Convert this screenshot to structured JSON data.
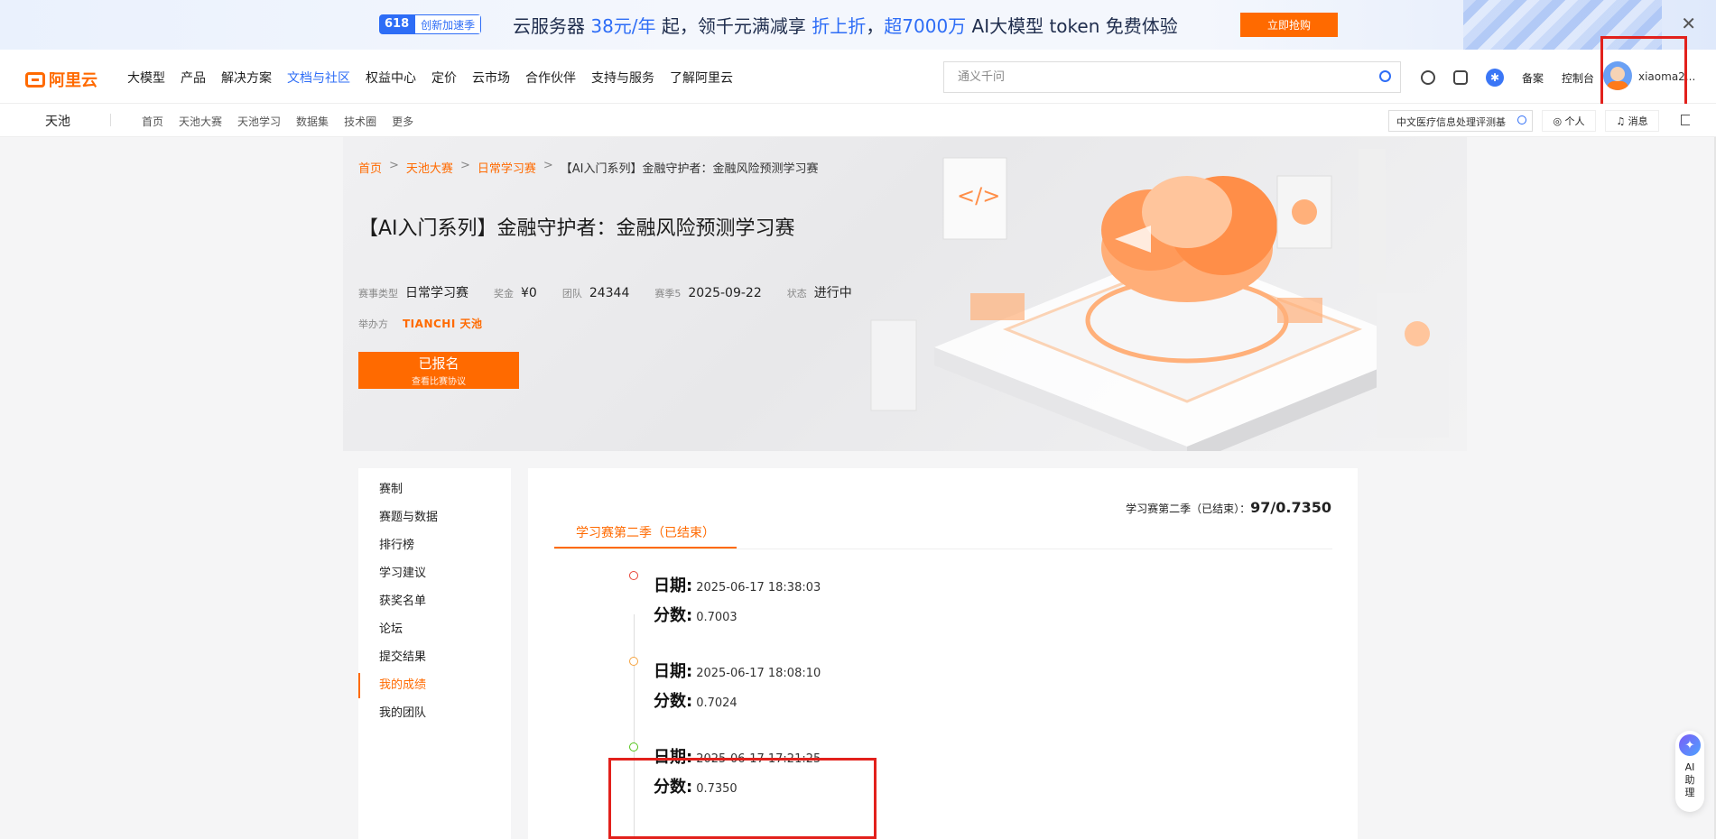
{
  "promo": {
    "badge_618": "618",
    "badge_text": "创新加速季",
    "text_prefix": "云服务器 ",
    "text_price": "38元/年",
    "text_mid": " 起，领千元满减享 ",
    "text_discount": "折上折",
    "text_sep": "，",
    "text_tokens": "超7000万",
    "text_suffix": " AI大模型 token 免费体验",
    "cta": "立即抢购",
    "close": "✕"
  },
  "nav": {
    "logo": "阿里云",
    "items": [
      "大模型",
      "产品",
      "解决方案",
      "文档与社区",
      "权益中心",
      "定价",
      "云市场",
      "合作伙伴",
      "支持与服务",
      "了解阿里云"
    ],
    "active_index": 3,
    "search_placeholder": "通义千问",
    "icon_blue_label": "✱",
    "beian": "备案",
    "console": "控制台",
    "username": "xiaoma2..."
  },
  "subnav": {
    "brand": "天池",
    "items": [
      "首页",
      "天池大赛",
      "天池学习",
      "数据集",
      "技术圈",
      "更多"
    ],
    "comp_search": "中文医疗信息处理评测基",
    "personal": "◎ 个人",
    "messages": "♫ 消息"
  },
  "hero": {
    "breadcrumb": [
      "首页",
      "天池大赛",
      "日常学习赛",
      "【AI入门系列】金融守护者：金融风险预测学习赛"
    ],
    "title": "【AI入门系列】金融守护者：金融风险预测学习赛",
    "meta": [
      {
        "k": "赛事类型",
        "v": "日常学习赛"
      },
      {
        "k": "奖金",
        "v": "¥0"
      },
      {
        "k": "团队",
        "v": "24344"
      },
      {
        "k": "赛季5",
        "v": "2025-09-22"
      },
      {
        "k": "状态",
        "v": "进行中"
      }
    ],
    "organizer_label": "举办方",
    "organizer_name": "TIANCHI 天池",
    "signed_main": "已报名",
    "signed_sub": "查看比赛协议"
  },
  "sidemenu": {
    "items": [
      "赛制",
      "赛题与数据",
      "排行榜",
      "学习建议",
      "获奖名单",
      "论坛",
      "提交结果",
      "我的成绩",
      "我的团队"
    ],
    "active_index": 7
  },
  "panel": {
    "summary_label": "学习赛第二季（已结束）：",
    "summary_value": "97/0.7350",
    "tab": "学习赛第二季（已结束）",
    "entries": [
      {
        "date_label": "日期:",
        "date": "2025-06-17 18:38:03",
        "score_label": "分数:",
        "score": "0.7003",
        "dot_color": "#e8463a"
      },
      {
        "date_label": "日期:",
        "date": "2025-06-17 18:08:10",
        "score_label": "分数:",
        "score": "0.7024",
        "dot_color": "#f5a340"
      },
      {
        "date_label": "日期:",
        "date": "2025-06-17 17:21:25",
        "score_label": "分数:",
        "score": "0.7350",
        "dot_color": "#52c41a"
      }
    ]
  },
  "ai_assist": {
    "logo": "✦",
    "text": "AI助理"
  },
  "colors": {
    "accent": "#ff6a00",
    "brand_blue": "#2e6df6",
    "highlight_red": "#e2211c"
  }
}
